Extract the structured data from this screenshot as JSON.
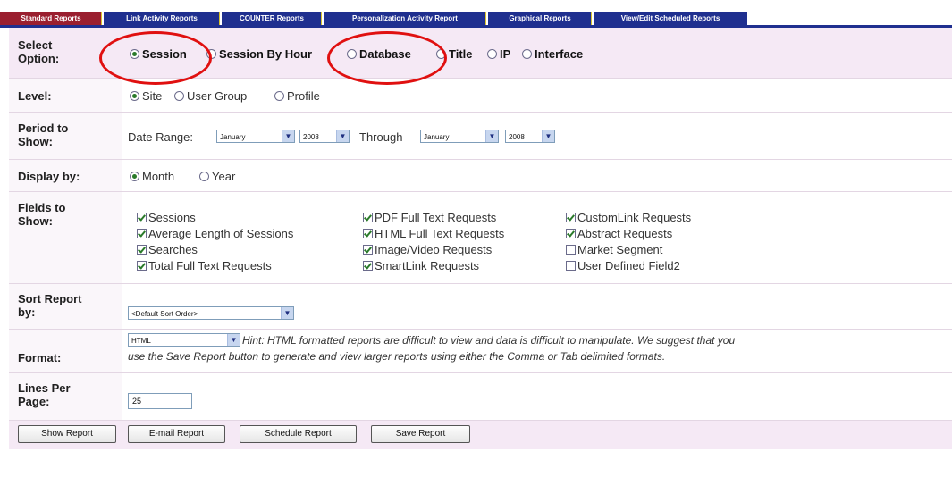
{
  "tabs": [
    {
      "label": "Standard Reports",
      "active": true
    },
    {
      "label": "Link Activity Reports",
      "active": false
    },
    {
      "label": "COUNTER Reports",
      "active": false
    },
    {
      "label": "Personalization Activity Report",
      "active": false
    },
    {
      "label": "Graphical Reports",
      "active": false
    },
    {
      "label": "View/Edit Scheduled Reports",
      "active": false
    }
  ],
  "select_option": {
    "label": "Select Option:",
    "options": [
      "Session",
      "Session By Hour",
      "Database",
      "Title",
      "IP",
      "Interface"
    ],
    "selected": "Session"
  },
  "level": {
    "label": "Level:",
    "options": [
      "Site",
      "User Group",
      "Profile"
    ],
    "selected": "Site"
  },
  "period": {
    "label": "Period to Show:",
    "date_range_label": "Date Range:",
    "from_month": "January",
    "from_year": "2008",
    "through_label": "Through",
    "to_month": "January",
    "to_year": "2008"
  },
  "display_by": {
    "label": "Display by:",
    "options": [
      "Month",
      "Year"
    ],
    "selected": "Month"
  },
  "fields": {
    "label": "Fields to Show:",
    "items": [
      {
        "label": "Sessions",
        "checked": true
      },
      {
        "label": "Average Length of Sessions",
        "checked": true
      },
      {
        "label": "Searches",
        "checked": true
      },
      {
        "label": "Total Full Text Requests",
        "checked": true
      },
      {
        "label": "PDF Full Text Requests",
        "checked": true
      },
      {
        "label": "HTML Full Text Requests",
        "checked": true
      },
      {
        "label": "Image/Video Requests",
        "checked": true
      },
      {
        "label": "SmartLink Requests",
        "checked": true
      },
      {
        "label": "CustomLink Requests",
        "checked": true
      },
      {
        "label": "Abstract Requests",
        "checked": true
      },
      {
        "label": "Market Segment",
        "checked": false
      },
      {
        "label": "User Defined Field2",
        "checked": false
      }
    ]
  },
  "sort": {
    "label": "Sort Report by:",
    "value": "<Default Sort Order>"
  },
  "format": {
    "label": "Format:",
    "value": "HTML",
    "hint_line1": "Hint: HTML formatted reports are difficult to view and data is difficult to manipulate. We suggest that you",
    "hint_line2": "use the Save Report button to generate and view larger reports using either the Comma or Tab delimited formats."
  },
  "lines_per_page": {
    "label": "Lines Per Page:",
    "value": "25"
  },
  "buttons": {
    "show": "Show Report",
    "email": "E-mail Report",
    "schedule": "Schedule Report",
    "save": "Save Report"
  },
  "colors": {
    "tab_blue": "#1f2f8f",
    "tab_active": "#9a1f2f",
    "highlight_red": "#e01010"
  }
}
